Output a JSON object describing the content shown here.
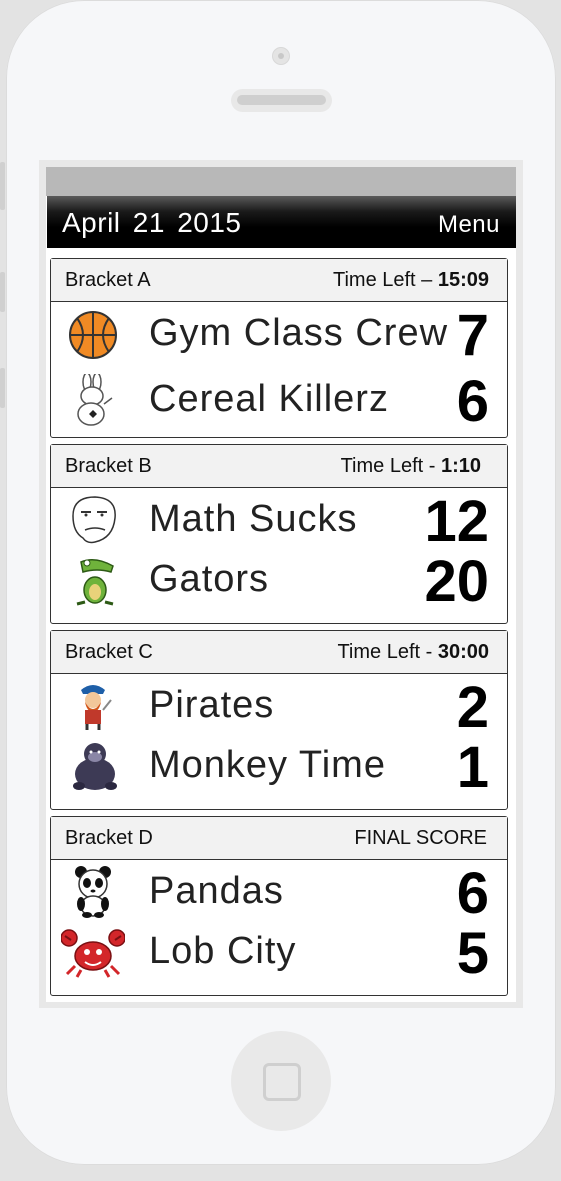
{
  "header": {
    "date": "April 21 2015",
    "menu_label": "Menu"
  },
  "brackets": [
    {
      "name": "Bracket A",
      "time_label": "Time Left – ",
      "time_value": "15:09",
      "teams": [
        {
          "name": "Gym Class Crew",
          "score": "7",
          "icon": "basketball-icon"
        },
        {
          "name": "Cereal Killerz",
          "score": "6",
          "icon": "bunny-icon"
        }
      ]
    },
    {
      "name": "Bracket B",
      "time_label": "Time Left - ",
      "time_value": "1:10",
      "teams": [
        {
          "name": "Math Sucks",
          "score": "12",
          "icon": "meme-face-icon"
        },
        {
          "name": "Gators",
          "score": "20",
          "icon": "alligator-icon"
        }
      ]
    },
    {
      "name": "Bracket C",
      "time_label": "Time Left - ",
      "time_value": "30:00",
      "teams": [
        {
          "name": "Pirates",
          "score": "2",
          "icon": "pirate-icon"
        },
        {
          "name": "Monkey Time",
          "score": "1",
          "icon": "gorilla-icon"
        }
      ]
    },
    {
      "name": "Bracket D",
      "time_label": "FINAL SCORE",
      "time_value": "",
      "teams": [
        {
          "name": "Pandas",
          "score": "6",
          "icon": "panda-icon"
        },
        {
          "name": "Lob City",
          "score": "5",
          "icon": "crab-icon"
        }
      ]
    }
  ]
}
